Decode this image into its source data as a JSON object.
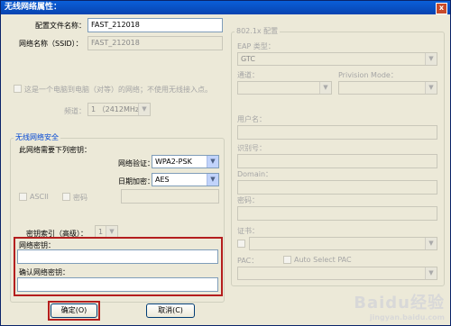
{
  "window": {
    "title": "无线网络属性：",
    "close": "x"
  },
  "left": {
    "config_name_label": "配置文件名称：",
    "config_name_value": "FAST_212018",
    "ssid_label": "网络名称（SSID）：",
    "ssid_value": "FAST_212018",
    "adhoc_label": "这是一个电脑到电脑（对等）的网络；不使用无线接入点。",
    "channel_label": "频道：",
    "channel_value": "1 （2412MHz）",
    "security_group_title": "无线网络安全",
    "requires_key_label": "此网络需要下列密钥：",
    "auth_label": "网络验证：",
    "auth_value": "WPA2-PSK",
    "encrypt_label": "日期加密：",
    "encrypt_value": "AES",
    "ascii_label": "ASCII",
    "password_label": "密码",
    "key_index_label": "密钥索引（高级）：",
    "key_index_value": "1",
    "net_key_label": "网络密钥：",
    "net_key_value": "",
    "confirm_key_label": "确认网络密钥：",
    "confirm_key_value": ""
  },
  "right": {
    "group_title": "802.1x 配置",
    "eap_label": "EAP 类型：",
    "eap_value": "GTC",
    "tunnel_label": "通道：",
    "provision_label": "Privision Mode：",
    "username_label": "用户名：",
    "identity_label": "识别号：",
    "domain_label": "Domain：",
    "password_label": "密码：",
    "cert_label": "证书：",
    "pac_label": "PAC：",
    "auto_pac_label": "Auto Select PAC"
  },
  "buttons": {
    "ok": "确定(O)",
    "cancel": "取消(C)"
  },
  "watermark": {
    "brand": "Baidu经验",
    "url": "jingyan.baidu.com"
  },
  "colors": {
    "highlight": "#b41e1e",
    "title_bar": "#0a5fd8",
    "group_title": "#0046d5"
  }
}
